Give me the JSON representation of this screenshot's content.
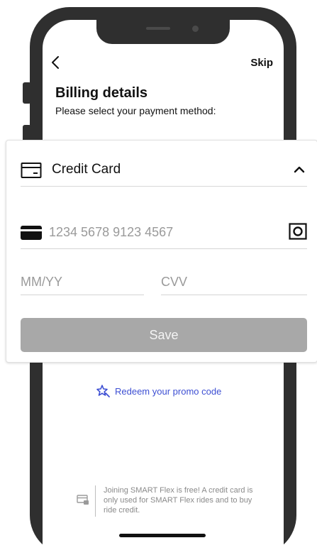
{
  "header": {
    "skip_label": "Skip",
    "title": "Billing details",
    "subtitle": "Please select your payment method:"
  },
  "payment_card": {
    "method_label": "Credit Card",
    "card_number_placeholder": "1234 5678 9123 4567",
    "expiry_placeholder": "MM/YY",
    "cvv_placeholder": "CVV",
    "save_label": "Save"
  },
  "promo": {
    "label": "Redeem your promo code"
  },
  "info": {
    "text": "Joining SMART Flex is free! A credit card is only used for SMART Flex rides and to buy ride credit."
  },
  "colors": {
    "accent": "#3d4fd3",
    "disabled_button": "#a8a8a8",
    "frame": "#2f2f2f"
  },
  "icons": {
    "back": "chevron-left-icon",
    "method": "credit-card-outline-icon",
    "collapse": "chevron-up-icon",
    "card": "credit-card-filled-icon",
    "scan": "camera-scan-icon",
    "promo": "star-ticket-icon",
    "info": "card-lock-icon"
  }
}
